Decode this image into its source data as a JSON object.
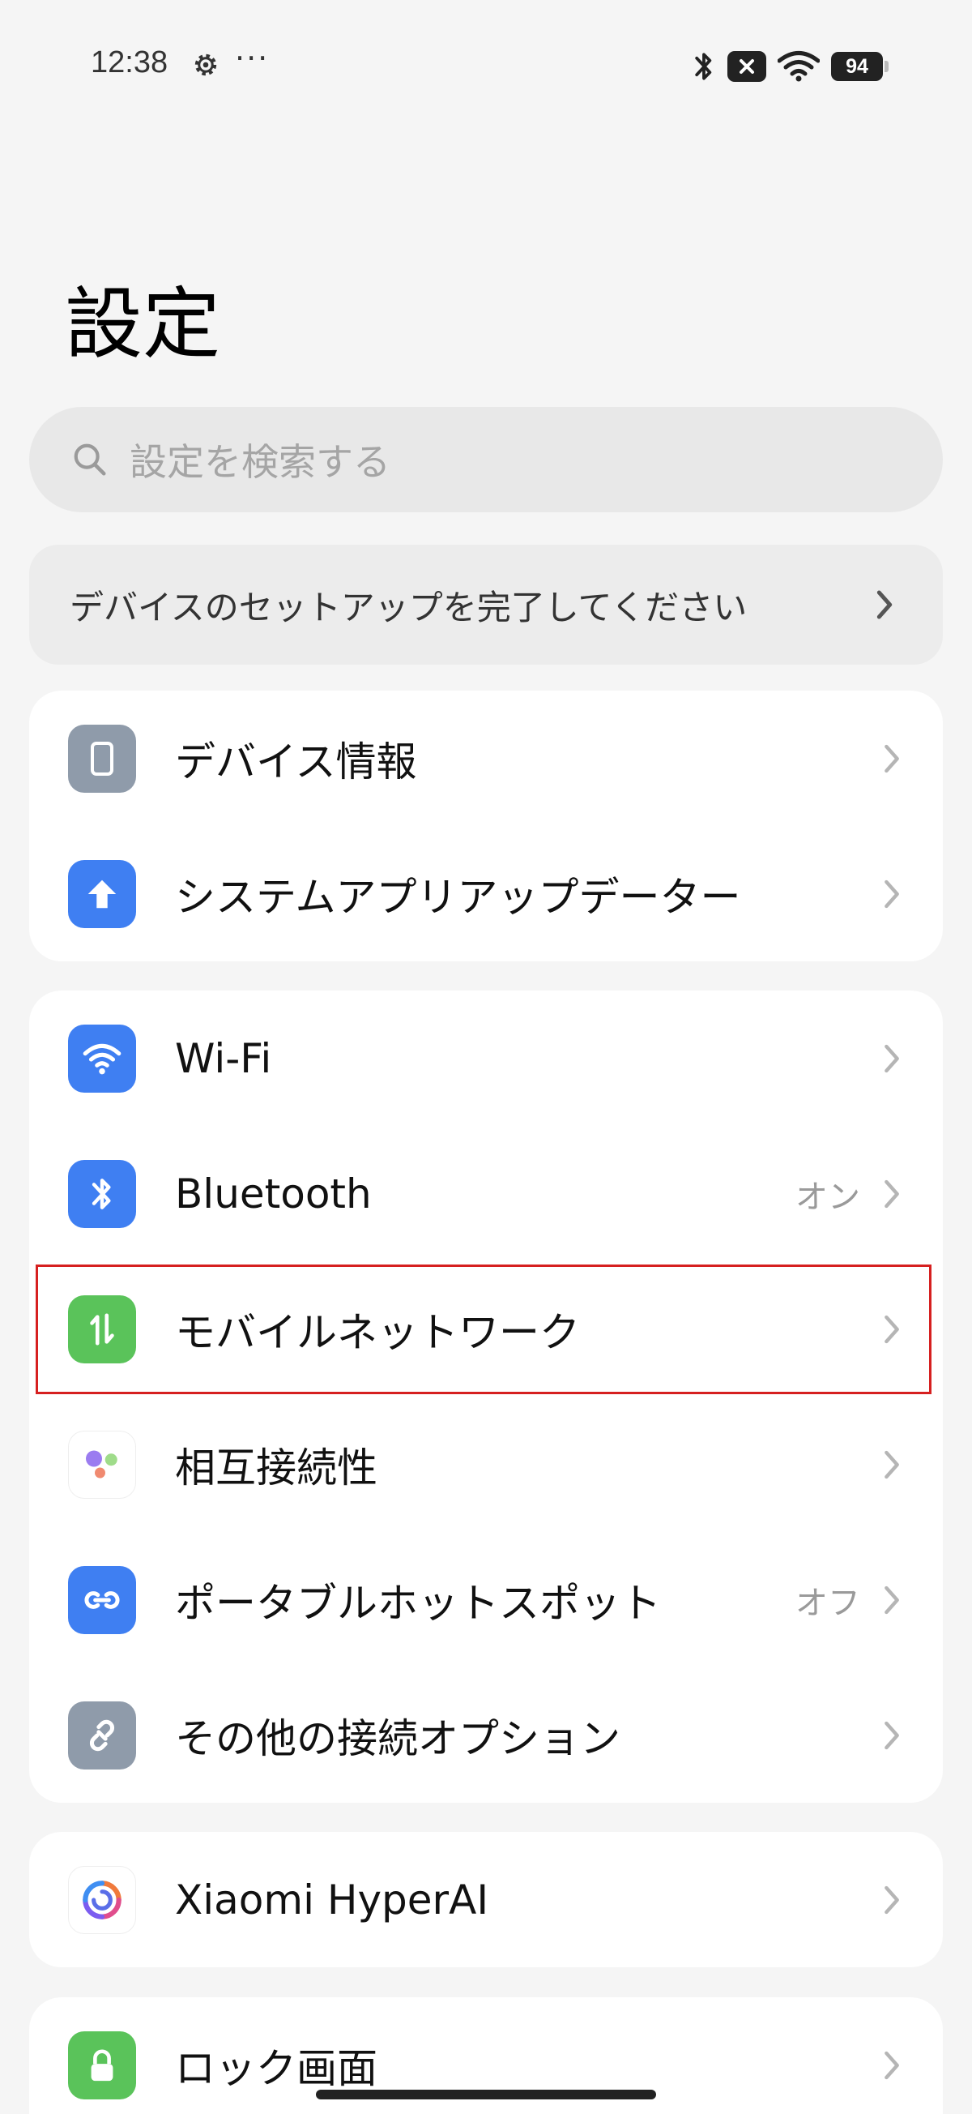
{
  "status_bar": {
    "time": "12:38",
    "more_indicator": "···",
    "battery": "94",
    "icons": [
      "settings-gear-icon",
      "bluetooth-icon",
      "no-sim-icon",
      "wifi-icon",
      "battery-icon"
    ]
  },
  "page": {
    "title": "設定"
  },
  "search": {
    "placeholder": "設定を検索する"
  },
  "setup_banner": {
    "label": "デバイスのセットアップを完了してください"
  },
  "groups": [
    {
      "items": [
        {
          "label": "デバイス情報",
          "icon": "phone-icon",
          "icon_color": "#8f9baa",
          "status": ""
        },
        {
          "label": "システムアプリアップデーター",
          "icon": "arrow-up-icon",
          "icon_color": "#3f7ff2",
          "status": ""
        }
      ]
    },
    {
      "items": [
        {
          "label": "Wi-Fi",
          "icon": "wifi-icon",
          "icon_color": "#3f7ff2",
          "status": ""
        },
        {
          "label": "Bluetooth",
          "icon": "bluetooth-icon",
          "icon_color": "#3f7ff2",
          "status": "オン"
        },
        {
          "label": "モバイルネットワーク",
          "icon": "mobile-data-icon",
          "icon_color": "#5ac35a",
          "status": "",
          "highlighted": true
        },
        {
          "label": "相互接続性",
          "icon": "interconnectivity-icon",
          "icon_color": "#ffffff",
          "status": ""
        },
        {
          "label": "ポータブルホットスポット",
          "icon": "hotspot-icon",
          "icon_color": "#3f7ff2",
          "status": "オフ"
        },
        {
          "label": "その他の接続オプション",
          "icon": "link-icon",
          "icon_color": "#8f9baa",
          "status": ""
        }
      ]
    },
    {
      "items": [
        {
          "label": "Xiaomi HyperAI",
          "icon": "hyperai-icon",
          "icon_color": "#ffffff",
          "status": ""
        }
      ]
    },
    {
      "items": [
        {
          "label": "ロック画面",
          "icon": "lock-icon",
          "icon_color": "#5ac35a",
          "status": ""
        }
      ]
    }
  ],
  "highlight_color": "#d62020"
}
